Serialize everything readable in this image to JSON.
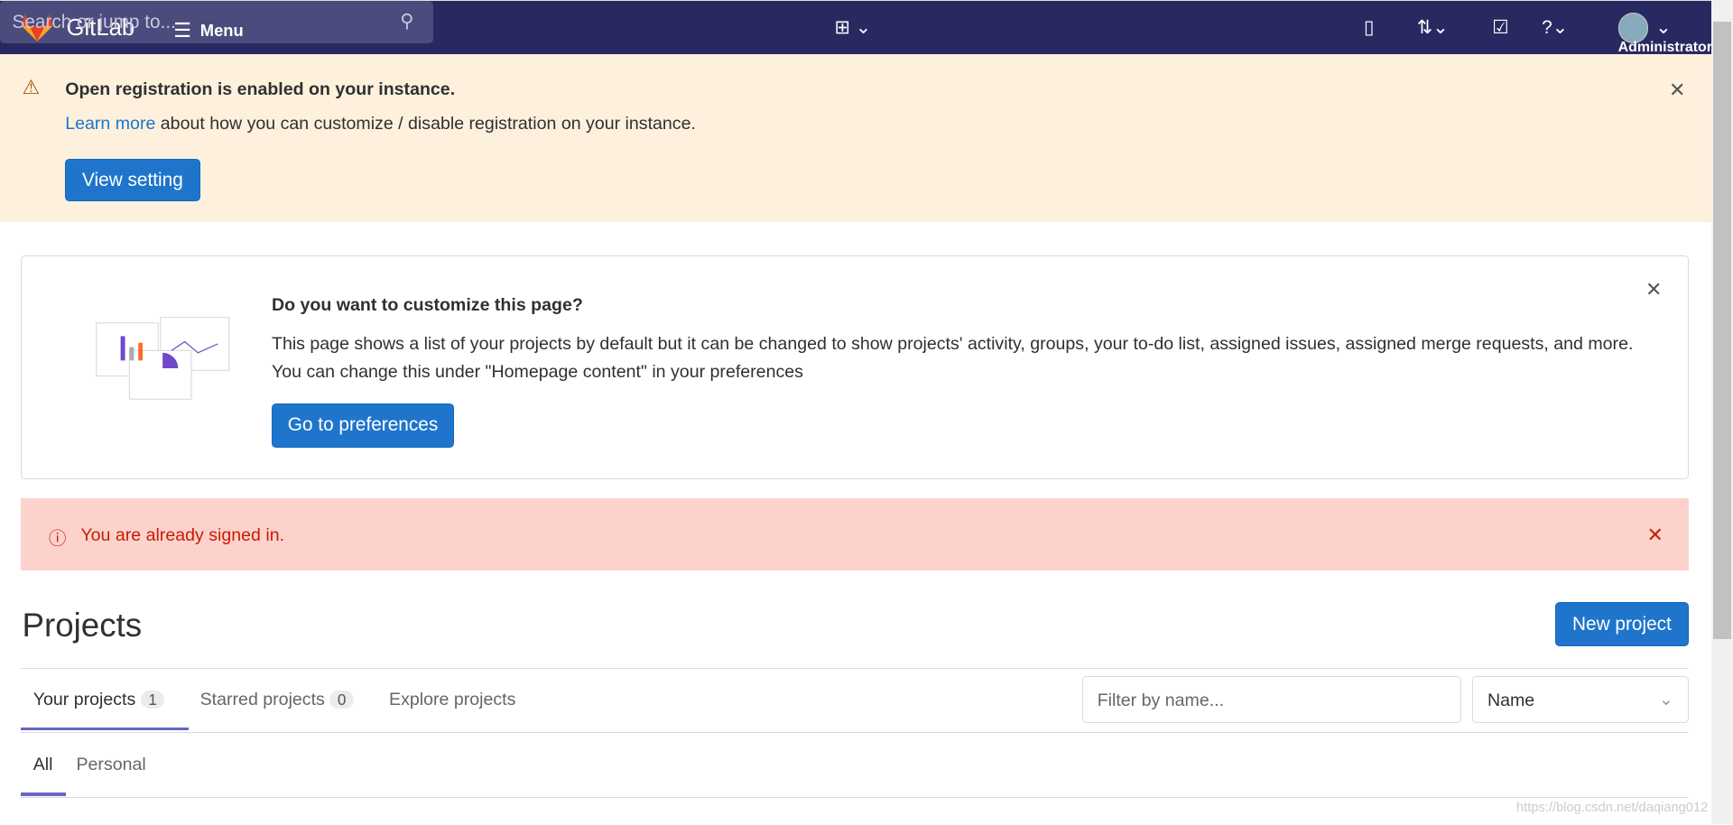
{
  "nav": {
    "brand": "GitLab",
    "menu": "Menu",
    "search_placeholder": "Search or jump to...",
    "user": "Administrator"
  },
  "banner": {
    "title": "Open registration is enabled on your instance.",
    "link": "Learn more",
    "text": " about how you can customize / disable registration on your instance.",
    "button": "View setting"
  },
  "customize": {
    "title": "Do you want to customize this page?",
    "body": "This page shows a list of your projects by default but it can be changed to show projects' activity, groups, your to-do list, assigned issues, assigned merge requests, and more. You can change this under \"Homepage content\" in your preferences",
    "button": "Go to preferences"
  },
  "alert": {
    "text": "You are already signed in."
  },
  "projects": {
    "title": "Projects",
    "new_button": "New project",
    "tabs": [
      {
        "label": "Your projects",
        "count": "1"
      },
      {
        "label": "Starred projects",
        "count": "0"
      },
      {
        "label": "Explore projects"
      }
    ],
    "filter_placeholder": "Filter by name...",
    "sort": "Name",
    "subtabs": [
      "All",
      "Personal"
    ]
  },
  "watermark": "https://blog.csdn.net/daqiang012",
  "colors": {
    "nav": "#292961",
    "primary": "#1f75cb",
    "warning_bg": "#fdf1dd",
    "danger_bg": "#fcd2cd",
    "tab_active": "#6666c4"
  }
}
